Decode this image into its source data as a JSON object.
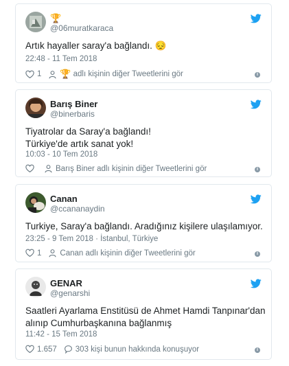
{
  "colors": {
    "twitter_blue": "#1da1f2",
    "meta_gray": "#697882",
    "border": "#e1e8ed"
  },
  "tweets": [
    {
      "name": "",
      "name_icon": "trophy-icon",
      "handle": "@06muratkaraca",
      "lines": [
        "Artık hayaller saray'a bağlandı. 😔"
      ],
      "timestamp": "22:48 - 11 Tem 2018",
      "likes": "1",
      "more_label": "adlı kişinin diğer Tweetlerini gör"
    },
    {
      "name": "Barış Biner",
      "handle": "@binerbaris",
      "lines": [
        "Tiyatrolar da Saray'a bağlandı!",
        "Türkiye'de artık sanat yok!"
      ],
      "timestamp": "10:03 - 10 Tem 2018",
      "more_label": "Barış Biner adlı kişinin diğer Tweetlerini gör"
    },
    {
      "name": "Canan",
      "handle": "@ccananaydin",
      "lines": [
        "Turkiye, Saray'a bağlandı. Aradığınız kişilere ulaşılamıyor."
      ],
      "timestamp": "23:25 - 9 Tem 2018 · İstanbul, Türkiye",
      "likes": "1",
      "more_label": "Canan adlı kişinin diğer Tweetlerini gör"
    },
    {
      "name": "GENAR",
      "handle": "@genarshi",
      "lines": [
        "Saatleri Ayarlama Enstitüsü de Ahmet Hamdi Tanpınar'dan",
        "alınıp Cumhurbaşkanına bağlanmış"
      ],
      "timestamp": "11:42 - 15 Tem 2018",
      "likes": "1.657",
      "replies_label": "303 kişi bunun hakkında konuşuyor"
    }
  ]
}
